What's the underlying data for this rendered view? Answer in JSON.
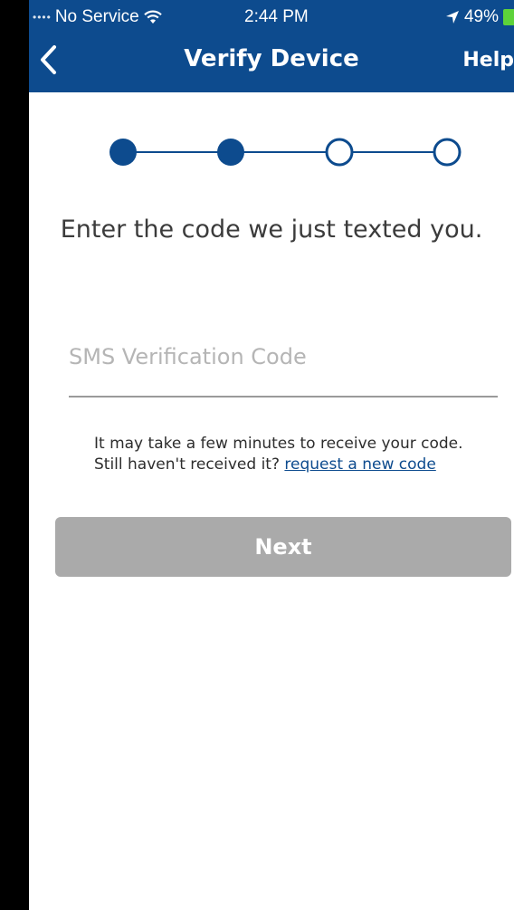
{
  "status_bar": {
    "carrier": "No Service",
    "time": "2:44 PM",
    "battery": "49%"
  },
  "header": {
    "title": "Verify Device",
    "help": "Help"
  },
  "stepper": {
    "total_steps": 4,
    "completed_steps": 2
  },
  "content": {
    "instruction": "Enter the code we just texted you.",
    "code_field": {
      "placeholder": "SMS Verification Code",
      "value": ""
    },
    "note": "It may take a few minutes to receive your code. Still haven't received it?",
    "resend_link": "request a new code",
    "next_button": "Next"
  },
  "colors": {
    "brand": "#0d4b8e",
    "disabled_button": "#aaaaaa"
  }
}
